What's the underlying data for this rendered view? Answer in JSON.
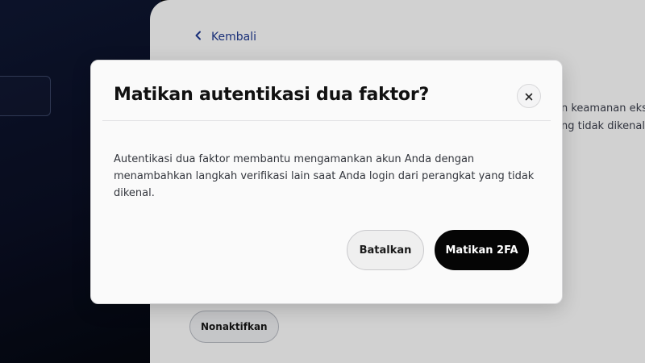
{
  "page": {
    "back_label": "Kembali",
    "background_text_line1": "n keamanan eks",
    "background_text_line2": "ng tidak dikenal.",
    "deactivate_button": "Nonaktifkan"
  },
  "modal": {
    "title": "Matikan autentikasi dua faktor?",
    "body": "Autentikasi dua faktor membantu mengamankan akun Anda dengan menambahkan langkah verifikasi lain saat Anda login dari perangkat yang tidak dikenal.",
    "cancel_label": "Batalkan",
    "confirm_label": "Matikan 2FA",
    "close_icon": "close-icon"
  },
  "colors": {
    "sidebar_bg": "#0a0f24",
    "link_color": "#1f3a93",
    "confirm_bg": "#050505",
    "cancel_bg": "#efefef"
  }
}
